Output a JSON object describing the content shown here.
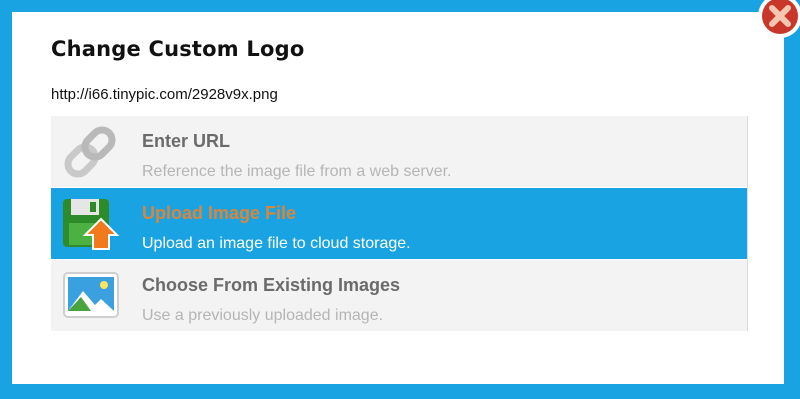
{
  "dialog": {
    "title": "Change Custom Logo",
    "current_url": "http://i66.tinypic.com/2928v9x.png"
  },
  "options": [
    {
      "title": "Enter URL",
      "description": "Reference the image file from a web server.",
      "icon": "link-chain-icon",
      "selected": false
    },
    {
      "title": "Upload Image File",
      "description": "Upload an image file to cloud storage.",
      "icon": "floppy-upload-icon",
      "selected": true
    },
    {
      "title": "Choose From Existing Images",
      "description": "Use a previously uploaded image.",
      "icon": "image-gallery-icon",
      "selected": false
    }
  ],
  "close": {
    "icon": "close-icon"
  },
  "colors": {
    "accent": "#1aa3e3",
    "option_bg": "#f3f3f3",
    "close_red": "#c8372a"
  }
}
